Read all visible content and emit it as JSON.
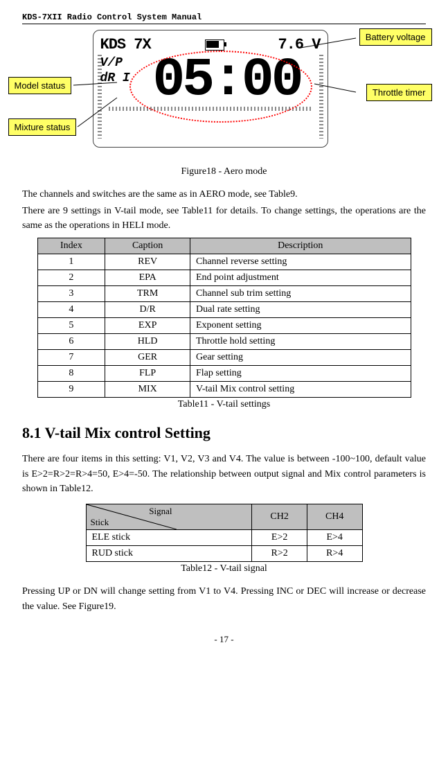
{
  "header": "KDS-7XII Radio Control System Manual",
  "lcd": {
    "brand": "KDS 7X",
    "voltage": "7.6 V",
    "label1": "V/P",
    "label2": "dR I",
    "time": "05:00"
  },
  "callouts": {
    "battery": "Battery voltage",
    "throttle": "Throttle timer",
    "model": "Model status",
    "mixture": "Mixture status"
  },
  "fig18": "Figure18 - Aero mode",
  "para1": "The channels and switches are the same as in AERO mode, see Table9.",
  "para2": "There are 9 settings in V-tail mode, see Table11 for details. To change settings, the operations are the same as the operations in HELI mode.",
  "table11": {
    "headers": [
      "Index",
      "Caption",
      "Description"
    ],
    "rows": [
      [
        "1",
        "REV",
        "Channel reverse setting"
      ],
      [
        "2",
        "EPA",
        "End point adjustment"
      ],
      [
        "3",
        "TRM",
        "Channel sub trim setting"
      ],
      [
        "4",
        "D/R",
        "Dual rate setting"
      ],
      [
        "5",
        "EXP",
        "Exponent setting"
      ],
      [
        "6",
        "HLD",
        "Throttle hold setting"
      ],
      [
        "7",
        "GER",
        "Gear setting"
      ],
      [
        "8",
        "FLP",
        "Flap setting"
      ],
      [
        "9",
        "MIX",
        "V-tail Mix control setting"
      ]
    ],
    "caption": "Table11 - V-tail settings"
  },
  "sectionTitle": "8.1 V-tail Mix control Setting",
  "para3": "There are four items in this setting: V1, V2, V3 and V4. The value is between -100~100, default value is E>2=R>2=R>4=50, E>4=-50. The relationship between output signal and Mix control parameters is shown in Table12.",
  "table12": {
    "diagTop": "Signal",
    "diagBot": "Stick",
    "cols": [
      "CH2",
      "CH4"
    ],
    "rows": [
      [
        "ELE stick",
        "E>2",
        "E>4"
      ],
      [
        "RUD stick",
        "R>2",
        "R>4"
      ]
    ],
    "caption": "Table12 - V-tail signal"
  },
  "para4": "Pressing UP or DN will change setting from V1 to V4. Pressing INC or DEC will increase or decrease the value. See Figure19.",
  "footer": "- 17 -"
}
